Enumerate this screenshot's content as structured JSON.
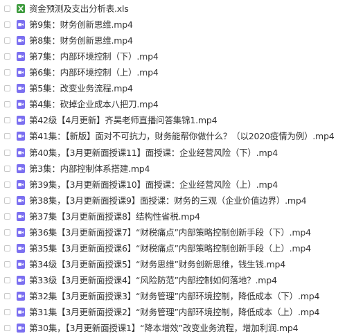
{
  "files": [
    {
      "name": "资金预测及支出分析表.xls",
      "icon": "excel-file-icon"
    },
    {
      "name": "第9集：财务创新思维.mp4",
      "icon": "video-file-icon"
    },
    {
      "name": "第8集：财务创新思维.mp4",
      "icon": "video-file-icon"
    },
    {
      "name": "第7集：内部环境控制（下）.mp4",
      "icon": "video-file-icon"
    },
    {
      "name": "第6集：内部环境控制（上）.mp4",
      "icon": "video-file-icon"
    },
    {
      "name": "第5集：改变业务流程.mp4",
      "icon": "video-file-icon"
    },
    {
      "name": "第4集：砍掉企业成本八把刀.mp4",
      "icon": "video-file-icon"
    },
    {
      "name": "第42级【4月更新】齐昊老师直播问答集锦1.mp4",
      "icon": "video-file-icon"
    },
    {
      "name": "第41集：【新版】面对不可抗力，财务能帮你做什么？（以2020疫情为例）.mp4",
      "icon": "video-file-icon"
    },
    {
      "name": "第40集，【3月更新面授课11】面授课：企业经营风险（下）.mp4",
      "icon": "video-file-icon"
    },
    {
      "name": "第3集：内部控制体系搭建.mp4",
      "icon": "video-file-icon"
    },
    {
      "name": "第39集，【3月更新面授课10】面授课：企业经营风险（上）.mp4",
      "icon": "video-file-icon"
    },
    {
      "name": "第38集，【3月更新面授课9】面授课：财务的三观（企业价值边界）.mp4",
      "icon": "video-file-icon"
    },
    {
      "name": "第37集【3月更新面授课8】结构性省税.mp4",
      "icon": "video-file-icon"
    },
    {
      "name": "第36集【3月更新面授课7】“财税痛点”内部策略控制创新手段（下）.mp4",
      "icon": "video-file-icon"
    },
    {
      "name": "第35集【3月更新面授课6】“财税痛点”内部策略控制创新手段（上）.mp4",
      "icon": "video-file-icon"
    },
    {
      "name": "第34级【3月更新面授课5】“财务思维”财务创新思维，钱生钱.mp4",
      "icon": "video-file-icon"
    },
    {
      "name": "第33级【3月更新面授课4】“风险防范”内部控制如何落地？.mp4",
      "icon": "video-file-icon"
    },
    {
      "name": "第32集【3月更新面授课3】“财务管理”内部环境控制，降低成本（下）.mp4",
      "icon": "video-file-icon"
    },
    {
      "name": "第31集【3月更新面授课2】“财务管理”内部环境控制，降低成本（上）.mp4",
      "icon": "video-file-icon"
    },
    {
      "name": "第30集，【3月更新面授课1】“降本增效”改变业务流程，增加利润.mp4",
      "icon": "video-file-icon"
    }
  ],
  "colors": {
    "excel": "#3c9b3c",
    "video": "#7b6ff0",
    "text": "#333333",
    "checkbox_border": "#c8c8c8"
  }
}
